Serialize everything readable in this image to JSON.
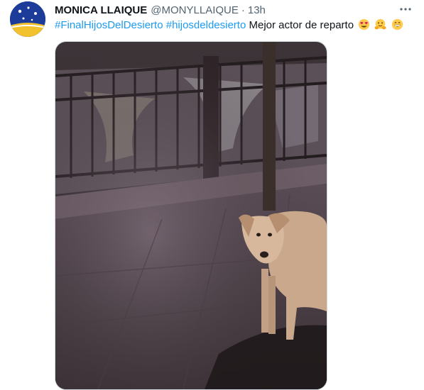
{
  "tweet": {
    "author": {
      "display_name": "MONICA LLAIQUE",
      "handle": "@MONYLLAIQUE",
      "avatar_icon": "flag-avatar-icon"
    },
    "separator": "·",
    "timestamp": "13h",
    "hashtags": [
      "#FinalHijosDelDesierto",
      "#hijosdeldesierto"
    ],
    "body_text": "Mejor actor de reparto",
    "emojis": [
      "heart-eyes-emoji-icon",
      "hugging-face-emoji-icon",
      "grinning-face-emoji-icon"
    ],
    "more_icon": "more-options-icon",
    "media": {
      "kind": "video-thumbnail",
      "subject_icon": "dog-on-sidewalk-image"
    }
  },
  "colors": {
    "hashtag": "#1d9bf0",
    "secondary_text": "#536471",
    "primary_text": "#0f1419"
  }
}
